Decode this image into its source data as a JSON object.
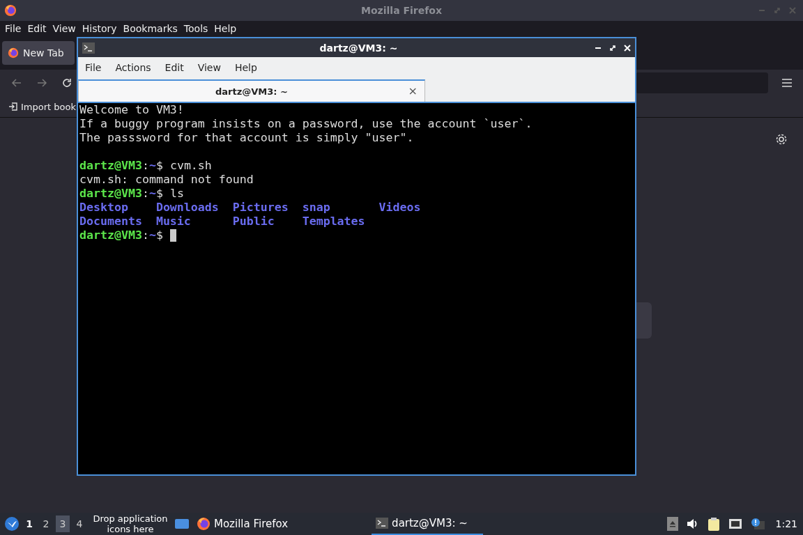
{
  "browser": {
    "title": "Mozilla Firefox",
    "menu": [
      "File",
      "Edit",
      "View",
      "History",
      "Bookmarks",
      "Tools",
      "Help"
    ],
    "tabs": [
      {
        "label": "New Tab",
        "selected": true
      }
    ],
    "bookmarks": [
      "Import book"
    ]
  },
  "terminal": {
    "title": "dartz@VM3: ~",
    "menu": [
      "File",
      "Actions",
      "Edit",
      "View",
      "Help"
    ],
    "tabs": [
      {
        "label": "dartz@VM3: ~",
        "selected": true
      }
    ],
    "close_glyph": "×",
    "lines": [
      {
        "kind": "text",
        "segments": [
          {
            "text": "Welcome to VM3!",
            "kind": "plain"
          }
        ]
      },
      {
        "kind": "text",
        "segments": [
          {
            "text": "If a buggy program insists on a password, use the account `user`.",
            "kind": "plain"
          }
        ]
      },
      {
        "kind": "text",
        "segments": [
          {
            "text": "The passsword for that account is simply \"user\".",
            "kind": "plain"
          }
        ]
      },
      {
        "kind": "blank"
      },
      {
        "kind": "text",
        "segments": [
          {
            "text": "dartz@VM3",
            "kind": "user"
          },
          {
            "text": ":",
            "kind": "plain"
          },
          {
            "text": "~",
            "kind": "path"
          },
          {
            "text": "$ cvm.sh",
            "kind": "plain"
          }
        ]
      },
      {
        "kind": "text",
        "segments": [
          {
            "text": "cvm.sh: command not found",
            "kind": "plain"
          }
        ]
      },
      {
        "kind": "text",
        "segments": [
          {
            "text": "dartz@VM3",
            "kind": "user"
          },
          {
            "text": ":",
            "kind": "plain"
          },
          {
            "text": "~",
            "kind": "path"
          },
          {
            "text": "$ ls",
            "kind": "plain"
          }
        ]
      },
      {
        "kind": "listing",
        "entries": [
          "Desktop",
          "Downloads",
          "Pictures",
          "snap",
          "Videos",
          "Documents",
          "Music",
          "Public",
          "Templates"
        ]
      },
      {
        "kind": "prompt",
        "segments": [
          {
            "text": "dartz@VM3",
            "kind": "user"
          },
          {
            "text": ":",
            "kind": "plain"
          },
          {
            "text": "~",
            "kind": "path"
          },
          {
            "text": "$",
            "kind": "plain"
          }
        ]
      }
    ]
  },
  "taskbar": {
    "workspaces": [
      {
        "label": "1",
        "active": true,
        "selected": false
      },
      {
        "label": "2",
        "active": false,
        "selected": false
      },
      {
        "label": "3",
        "active": false,
        "selected": true
      },
      {
        "label": "4",
        "active": false,
        "selected": false
      }
    ],
    "drop_hint": "Drop application icons here",
    "tasks": [
      {
        "label": "Mozilla Firefox",
        "kind": "firefox",
        "selected": false
      },
      {
        "label": "dartz@VM3: ~",
        "kind": "terminal",
        "selected": true
      }
    ],
    "clock": "1:21"
  }
}
